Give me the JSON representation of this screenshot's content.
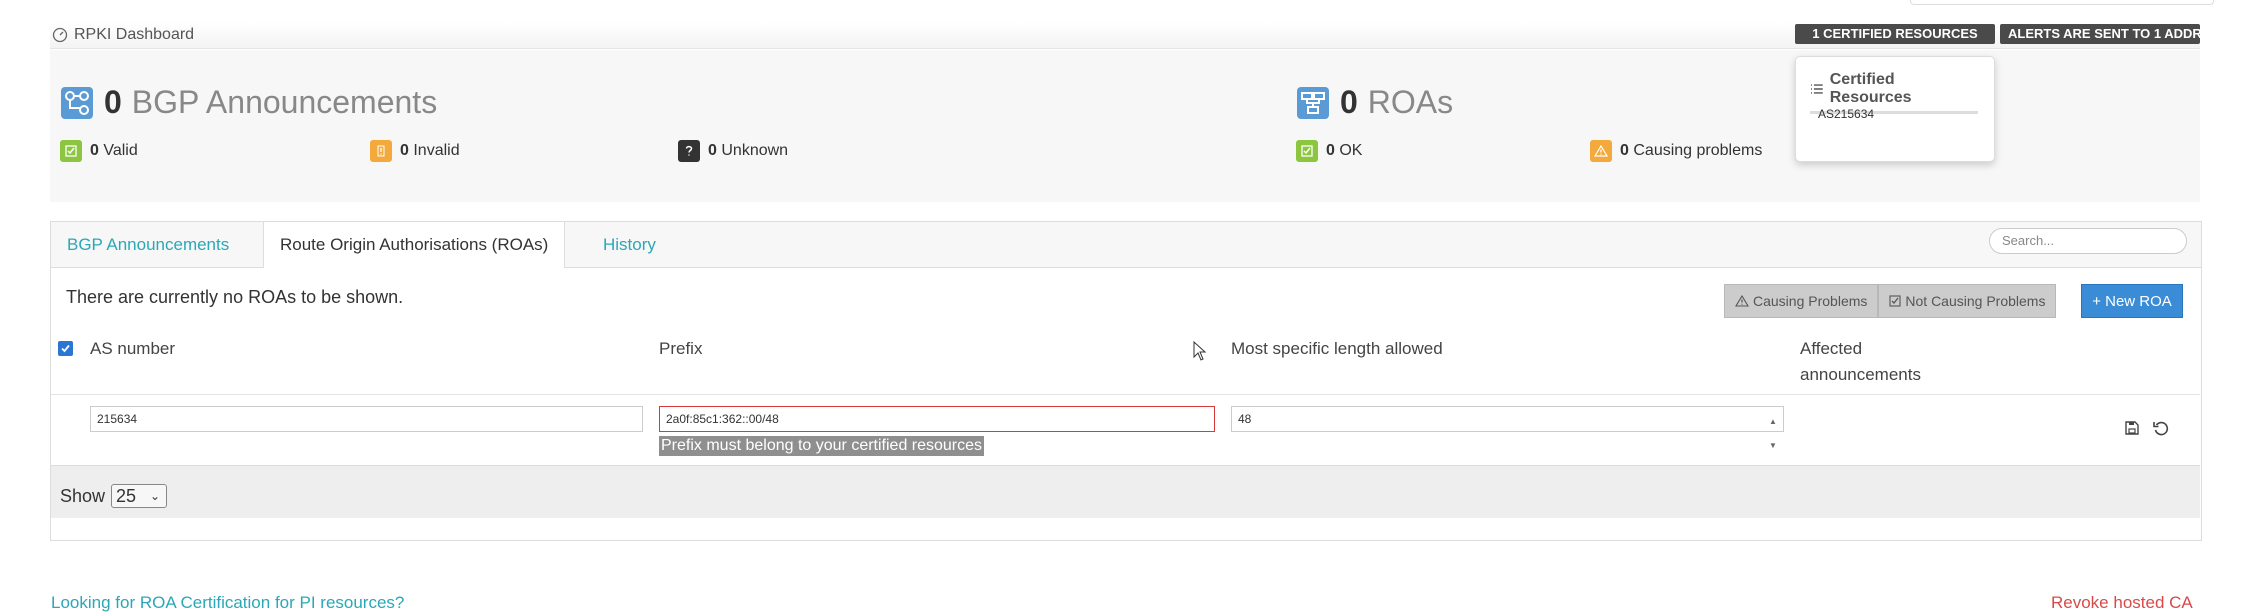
{
  "header": {
    "title": "RPKI Dashboard",
    "badge_certified": "1 CERTIFIED RESOURCES",
    "badge_alerts": "ALERTS ARE SENT TO 1 ADDR"
  },
  "bgp": {
    "count": "0",
    "label": "BGP Announcements",
    "valid_count": "0",
    "valid_label": "Valid",
    "invalid_count": "0",
    "invalid_label": "Invalid",
    "unknown_count": "0",
    "unknown_label": "Unknown"
  },
  "roas": {
    "count": "0",
    "label": "ROAs",
    "ok_count": "0",
    "ok_label": "OK",
    "problems_count": "0",
    "problems_label": "Causing problems"
  },
  "popup": {
    "title": "Certified Resources",
    "items": [
      "AS215634"
    ]
  },
  "tabs": {
    "bgp": "BGP Announcements",
    "roas": "Route Origin Authorisations (ROAs)",
    "history": "History"
  },
  "search": {
    "placeholder": "Search..."
  },
  "roas_panel": {
    "empty_text": "There are currently no ROAs to be shown.",
    "causing_problems": "Causing Problems",
    "not_causing_problems": "Not Causing Problems",
    "new_roa": "+ New ROA"
  },
  "columns": {
    "as_number": "AS number",
    "prefix": "Prefix",
    "max_length": "Most specific length allowed",
    "affected_line1": "Affected",
    "affected_line2": "announcements"
  },
  "new_row": {
    "as_value": "215634",
    "prefix_value": "2a0f:85c1:362::00/48",
    "max_length_value": "48",
    "error": "Prefix must belong to your certified resources"
  },
  "pagination": {
    "show_label": "Show",
    "page_size": "25"
  },
  "footer": {
    "pi_link": "Looking for ROA Certification for PI resources?",
    "revoke_link": "Revoke hosted CA"
  },
  "colors": {
    "accent": "#2aa8b7",
    "primary_button": "#3a8cd7",
    "valid": "#8cc63f",
    "warning": "#f3a93b",
    "error": "#d83a3a"
  }
}
